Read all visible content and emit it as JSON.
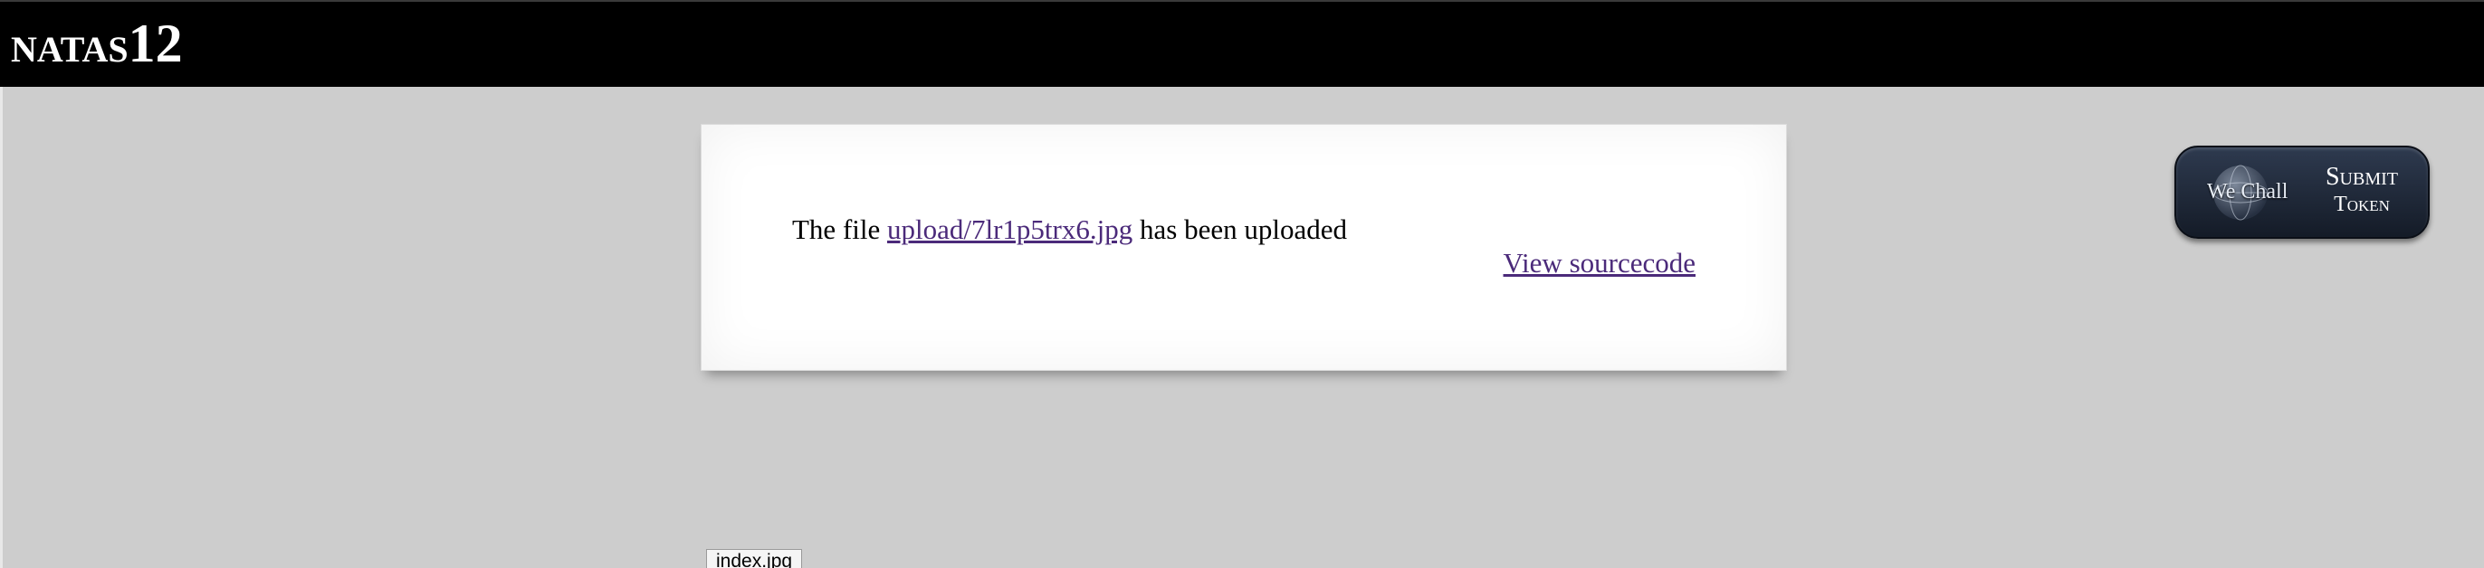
{
  "header": {
    "title_name": "NATAS",
    "title_number": "12"
  },
  "main": {
    "message_prefix": "The file ",
    "uploaded_file_link": "upload/7lr1p5trx6.jpg",
    "message_suffix": " has been uploaded",
    "view_source_link": "View sourcecode"
  },
  "wechall_button": {
    "logo_text": "We Chall",
    "line1": "Submit",
    "line2": "Token",
    "icon": "globe-icon"
  },
  "tooltip": {
    "text": "index.jpg"
  },
  "colors": {
    "background": "#cdcdcd",
    "header": "#000000",
    "link": "#4b2a7a"
  }
}
